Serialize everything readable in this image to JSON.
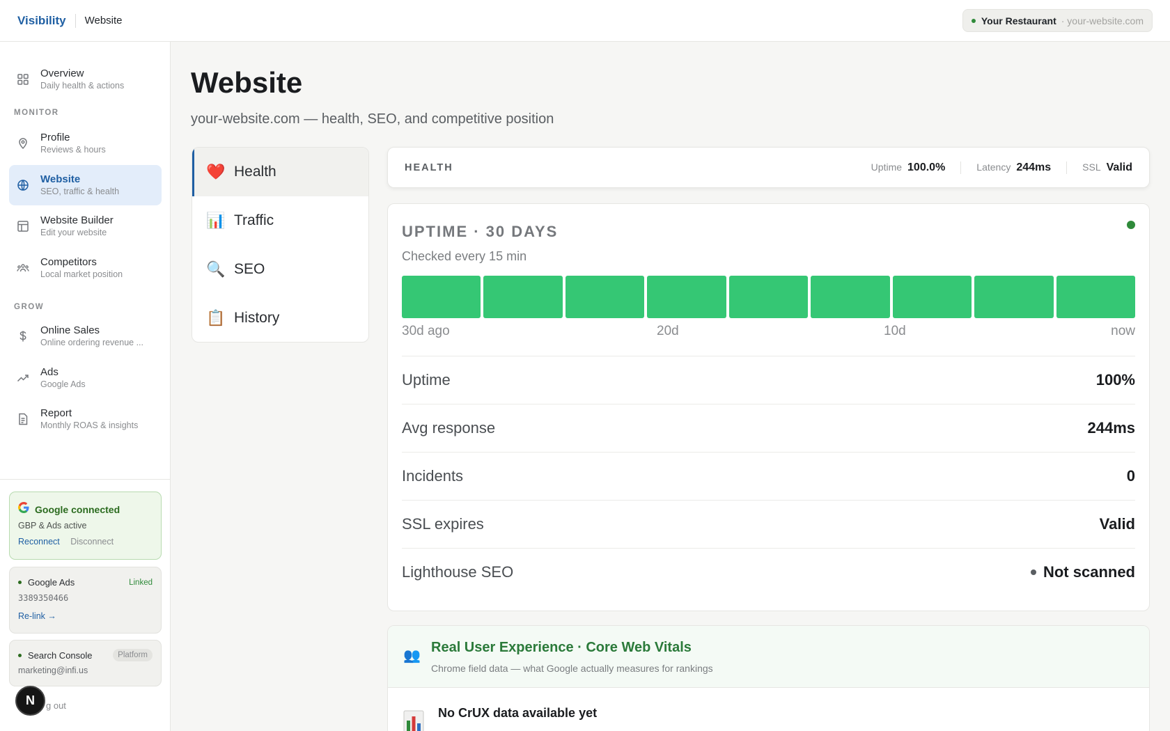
{
  "topbar": {
    "brand": "Visibility",
    "crumb": "Website",
    "restaurant": "Your Restaurant",
    "domain": "· your-website.com"
  },
  "sidebar": {
    "overview": {
      "title": "Overview",
      "sub": "Daily health & actions"
    },
    "section_monitor": "MONITOR",
    "monitor": [
      {
        "title": "Profile",
        "sub": "Reviews & hours"
      },
      {
        "title": "Website",
        "sub": "SEO, traffic & health"
      },
      {
        "title": "Website Builder",
        "sub": "Edit your website"
      },
      {
        "title": "Competitors",
        "sub": "Local market position"
      }
    ],
    "section_grow": "GROW",
    "grow": [
      {
        "title": "Online Sales",
        "sub": "Online ordering revenue ..."
      },
      {
        "title": "Ads",
        "sub": "Google Ads"
      },
      {
        "title": "Report",
        "sub": "Monthly ROAS & insights"
      }
    ],
    "google": {
      "title": "Google connected",
      "sub": "GBP & Ads active",
      "reconnect": "Reconnect",
      "disconnect": "Disconnect"
    },
    "ads": {
      "name": "Google Ads",
      "status": "Linked",
      "id": "3389350466",
      "relink": "Re-link →"
    },
    "console": {
      "name": "Search Console",
      "badge": "Platform",
      "email": "marketing@infi.us"
    },
    "signout": "g out",
    "avatar": "N"
  },
  "page": {
    "title": "Website",
    "subtitle": "your-website.com — health, SEO, and competitive position"
  },
  "tabs": [
    {
      "label": "Health",
      "icon": "heart-icon",
      "glyph": "❤️"
    },
    {
      "label": "Traffic",
      "icon": "bar-chart-icon",
      "glyph": "📊"
    },
    {
      "label": "SEO",
      "icon": "magnifier-icon",
      "glyph": "🔍"
    },
    {
      "label": "History",
      "icon": "clipboard-icon",
      "glyph": "📋"
    }
  ],
  "health_bar": {
    "label": "HEALTH",
    "uptime_k": "Uptime",
    "uptime_v": "100.0%",
    "latency_k": "Latency",
    "latency_v": "244ms",
    "ssl_k": "SSL",
    "ssl_v": "Valid"
  },
  "uptime": {
    "title": "UPTIME · 30 DAYS",
    "sub": "Checked every 15 min",
    "bar_color": "#35c774",
    "bar_count": 9,
    "axis": [
      "30d ago",
      "20d",
      "10d",
      "now"
    ],
    "rows": [
      {
        "k": "Uptime",
        "v": "100%"
      },
      {
        "k": "Avg response",
        "v": "244ms"
      },
      {
        "k": "Incidents",
        "v": "0"
      },
      {
        "k": "SSL expires",
        "v": "Valid"
      },
      {
        "k": "Lighthouse SEO",
        "v": "Not scanned"
      }
    ]
  },
  "crux": {
    "icon": "users-icon",
    "glyph": "👥",
    "title": "Real User Experience · Core Web Vitals",
    "sub": "Chrome field data — what Google actually measures for rankings",
    "empty_title": "No CrUX data available yet"
  }
}
